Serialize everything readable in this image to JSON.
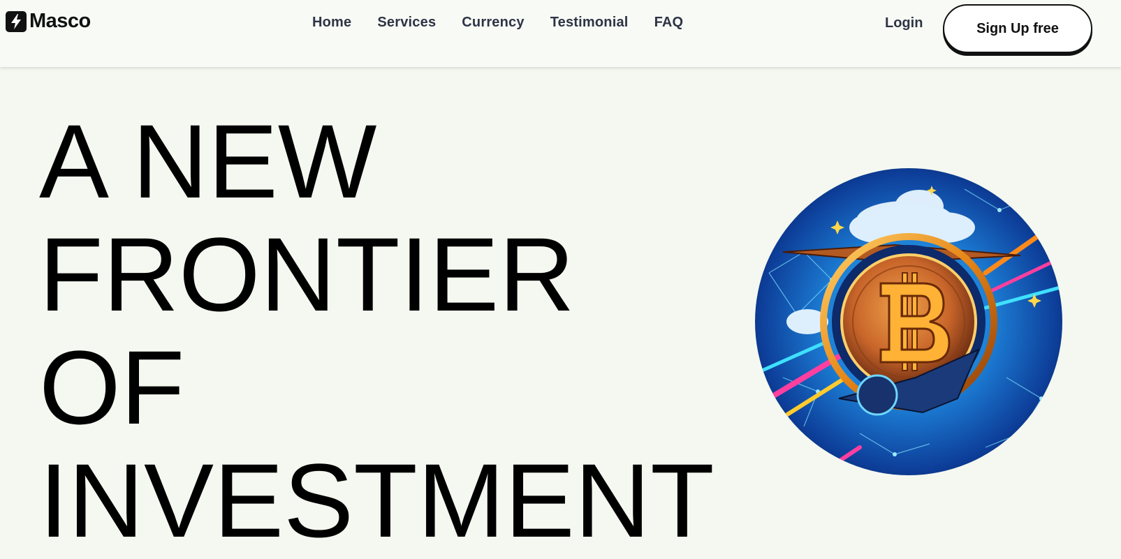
{
  "brand": {
    "name": "Masco",
    "icon": "lightning-bolt-icon"
  },
  "nav": {
    "links": [
      "Home",
      "Services",
      "Currency",
      "Testimonial",
      "FAQ"
    ]
  },
  "auth": {
    "login_label": "Login",
    "signup_label": "Sign Up free"
  },
  "hero": {
    "title_lines": [
      "A NEW",
      "FRONTIER",
      "OF",
      "INVESTMENT"
    ],
    "image": "bitcoin-coin-illustration"
  },
  "colors": {
    "background": "#f4f8f0",
    "navbar": "#f8fbf5",
    "nav_text": "#2e3446",
    "accent_orange": "#f39a1a",
    "deep_blue": "#0b2a6e"
  }
}
